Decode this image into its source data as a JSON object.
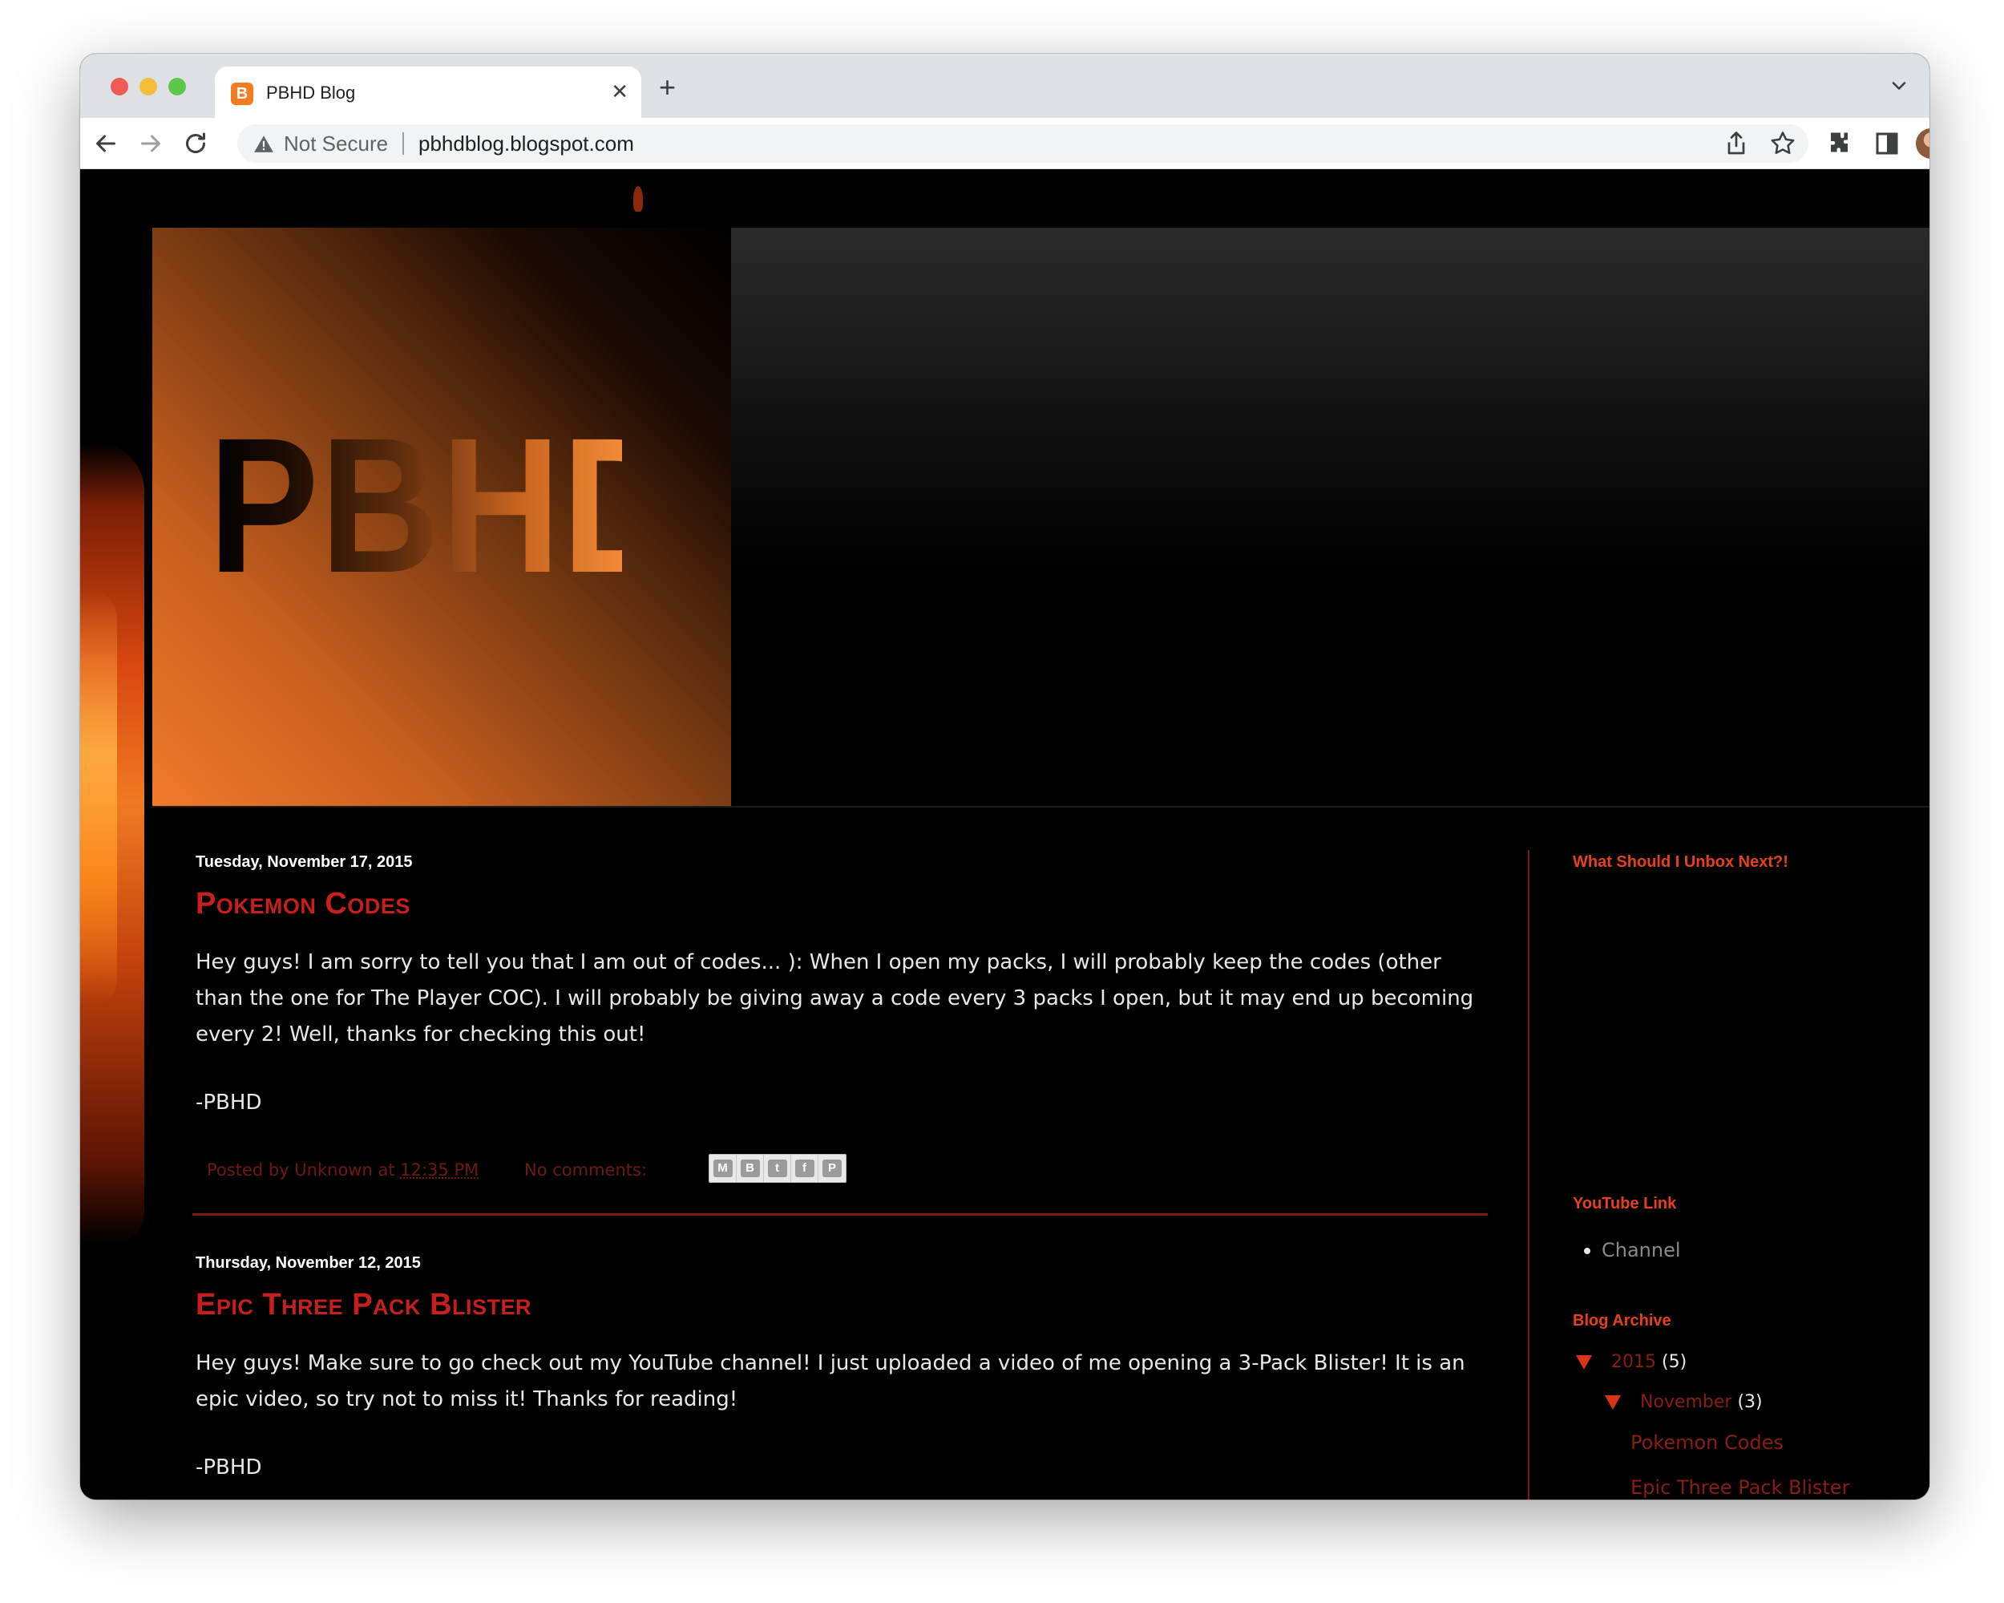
{
  "browser": {
    "tab_title": "PBHD Blog",
    "favicon_letter": "B",
    "close_glyph": "✕",
    "new_tab_glyph": "+",
    "security_label": "Not Secure",
    "url": "pbhdblog.blogspot.com",
    "icons": [
      "back-icon",
      "forward-icon",
      "reload-icon",
      "warning-icon",
      "share-icon",
      "bookmark-star-icon",
      "extensions-icon",
      "side-panel-icon",
      "profile-avatar",
      "more-menu-icon",
      "tab-search-icon"
    ]
  },
  "header": {
    "logo_text": "PBHD"
  },
  "posts": [
    {
      "date": "Tuesday, November 17, 2015",
      "title": "Pokemon Codes",
      "body": "Hey guys!  I am sorry to tell you that I am out of codes...  ):  When I open my packs, I will probably keep the codes (other than the one for The Player COC).  I will probably be giving away a code every 3 packs I open, but it may end up becoming every 2!  Well, thanks for checking this out!",
      "signature": "-PBHD",
      "posted_prefix": "Posted by Unknown at",
      "posted_time": "12:35 PM",
      "comments": "No comments:"
    },
    {
      "date": "Thursday, November 12, 2015",
      "title": "Epic Three Pack Blister",
      "body": "Hey guys!  Make sure to go check out my YouTube channel!  I just uploaded a video of me opening a 3-Pack Blister!  It is an epic video, so try not to miss it!  Thanks for reading!",
      "signature": "-PBHD"
    }
  ],
  "share_buttons": [
    {
      "name": "email-share-icon",
      "glyph": "M"
    },
    {
      "name": "blogthis-share-icon",
      "glyph": "B"
    },
    {
      "name": "twitter-share-icon",
      "glyph": "t"
    },
    {
      "name": "facebook-share-icon",
      "glyph": "f"
    },
    {
      "name": "pinterest-share-icon",
      "glyph": "P"
    }
  ],
  "sidebar": {
    "poll_title": "What Should I Unbox Next?!",
    "youtube_title": "YouTube Link",
    "youtube_links": [
      "Channel"
    ],
    "archive_title": "Blog Archive",
    "archive": {
      "year": "2015",
      "year_count": "(5)",
      "month": "November",
      "month_count": "(3)",
      "posts": [
        "Pokemon Codes",
        "Epic Three Pack Blister"
      ]
    }
  },
  "colors": {
    "accent_red": "#c81e1e",
    "sidebar_title": "#e8401c",
    "divider": "#7a1a12",
    "favicon": "#f47b21"
  }
}
